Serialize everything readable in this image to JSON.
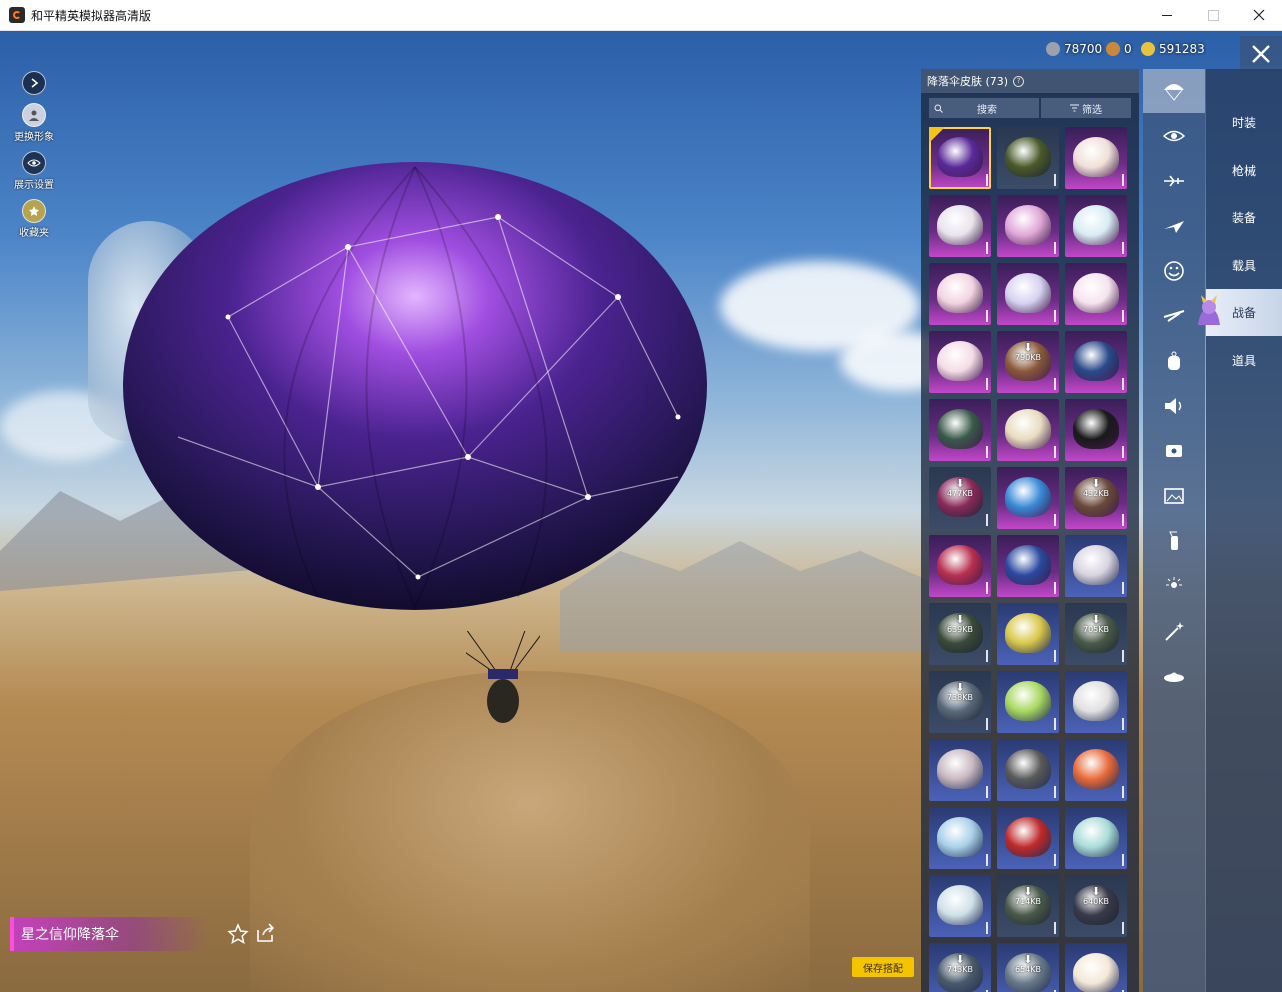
{
  "window": {
    "title": "和平精英模拟器高清版",
    "icons": [
      "app-icon",
      "minimize-icon",
      "maximize-icon",
      "close-icon"
    ]
  },
  "left_tools": [
    {
      "label": "",
      "icon": "play-icon"
    },
    {
      "label": "更换形象",
      "icon": "avatar-icon"
    },
    {
      "label": "展示设置",
      "icon": "eye-icon"
    },
    {
      "label": "收藏夹",
      "icon": "favorites-icon"
    }
  ],
  "currency": [
    {
      "value": "78700",
      "icon": "coin-icon",
      "color": "#9aa3ad"
    },
    {
      "value": "0",
      "icon": "medal-icon",
      "color": "#c88a3a"
    },
    {
      "value": "591283",
      "icon": "gold-coin-icon",
      "color": "#e8c340"
    }
  ],
  "item": {
    "name": "星之信仰降落伞"
  },
  "actions": {
    "save_label": "保存搭配"
  },
  "panel": {
    "title": "降落伞皮肤 (73)",
    "search_placeholder": "搜索",
    "filter_label": "筛选"
  },
  "skins": [
    {
      "bg": "purple",
      "color": "#5a2a9a",
      "selected": true,
      "dl": ""
    },
    {
      "bg": "dark",
      "color": "#4a5a2a",
      "selected": false,
      "dl": ""
    },
    {
      "bg": "purple",
      "color": "#f0e0d8",
      "selected": false,
      "dl": ""
    },
    {
      "bg": "purple",
      "color": "#e8e4ec",
      "selected": false,
      "dl": ""
    },
    {
      "bg": "purple",
      "color": "#e0a8d8",
      "selected": false,
      "dl": ""
    },
    {
      "bg": "purple",
      "color": "#d8ecf4",
      "selected": false,
      "dl": ""
    },
    {
      "bg": "purple",
      "color": "#f2d4e0",
      "selected": false,
      "dl": ""
    },
    {
      "bg": "purple",
      "color": "#d6d2f0",
      "selected": false,
      "dl": ""
    },
    {
      "bg": "purple",
      "color": "#f6e4ee",
      "selected": false,
      "dl": ""
    },
    {
      "bg": "purple",
      "color": "#f4dce6",
      "selected": false,
      "dl": ""
    },
    {
      "bg": "purple",
      "color": "#8a5a3a",
      "selected": false,
      "dl": "790KB"
    },
    {
      "bg": "purple",
      "color": "#2a4a8a",
      "selected": false,
      "dl": ""
    },
    {
      "bg": "purple",
      "color": "#3a5a4a",
      "selected": false,
      "dl": ""
    },
    {
      "bg": "purple",
      "color": "#e8dcc0",
      "selected": false,
      "dl": ""
    },
    {
      "bg": "purple",
      "color": "#1a1a1a",
      "selected": false,
      "dl": ""
    },
    {
      "bg": "dark",
      "color": "#8a2a5a",
      "selected": false,
      "dl": "477KB"
    },
    {
      "bg": "purple",
      "color": "#3a8ad8",
      "selected": false,
      "dl": ""
    },
    {
      "bg": "purple",
      "color": "#6a4a3a",
      "selected": false,
      "dl": "432KB"
    },
    {
      "bg": "purple",
      "color": "#b83050",
      "selected": false,
      "dl": ""
    },
    {
      "bg": "purple",
      "color": "#2a4aa0",
      "selected": false,
      "dl": ""
    },
    {
      "bg": "blue",
      "color": "#d8d4e0",
      "selected": false,
      "dl": ""
    },
    {
      "bg": "dark",
      "color": "#3a4a3a",
      "selected": false,
      "dl": "639KB"
    },
    {
      "bg": "blue",
      "color": "#d8c84a",
      "selected": false,
      "dl": ""
    },
    {
      "bg": "dark",
      "color": "#4a5a4a",
      "selected": false,
      "dl": "705KB"
    },
    {
      "bg": "dark",
      "color": "#5a6a7a",
      "selected": false,
      "dl": "738KB"
    },
    {
      "bg": "blue",
      "color": "#a8d860",
      "selected": false,
      "dl": ""
    },
    {
      "bg": "blue",
      "color": "#e0e0e0",
      "selected": false,
      "dl": ""
    },
    {
      "bg": "blue",
      "color": "#c8b8c0",
      "selected": false,
      "dl": ""
    },
    {
      "bg": "blue",
      "color": "#5a5a5a",
      "selected": false,
      "dl": ""
    },
    {
      "bg": "blue",
      "color": "#e86a3a",
      "selected": false,
      "dl": ""
    },
    {
      "bg": "blue",
      "color": "#a8d0e8",
      "selected": false,
      "dl": ""
    },
    {
      "bg": "blue",
      "color": "#c02a2a",
      "selected": false,
      "dl": ""
    },
    {
      "bg": "blue",
      "color": "#a8dcd8",
      "selected": false,
      "dl": ""
    },
    {
      "bg": "blue",
      "color": "#d0e0e8",
      "selected": false,
      "dl": ""
    },
    {
      "bg": "dark",
      "color": "#4a5a4a",
      "selected": false,
      "dl": "714KB"
    },
    {
      "bg": "dark",
      "color": "#3a3a4a",
      "selected": false,
      "dl": "640KB"
    },
    {
      "bg": "blue",
      "color": "#4a5a6a",
      "selected": false,
      "dl": "743KB"
    },
    {
      "bg": "blue",
      "color": "#6a7a8a",
      "selected": false,
      "dl": "654KB"
    },
    {
      "bg": "blue",
      "color": "#f4e8d8",
      "selected": false,
      "dl": ""
    }
  ],
  "side_icons": [
    "parachute-icon",
    "eye-icon",
    "plane-icon",
    "jet-icon",
    "emote-icon",
    "glider-icon",
    "backpack-icon",
    "speaker-icon",
    "kill-broadcast-icon",
    "photo-frame-icon",
    "fire-extinguisher-icon",
    "tap-effect-icon",
    "sparkle-wand-icon",
    "ufo-icon"
  ],
  "categories": [
    {
      "label": "时装",
      "active": false
    },
    {
      "label": "枪械",
      "active": false
    },
    {
      "label": "装备",
      "active": false
    },
    {
      "label": "载具",
      "active": false
    },
    {
      "label": "战备",
      "active": true
    },
    {
      "label": "道具",
      "active": false
    }
  ]
}
